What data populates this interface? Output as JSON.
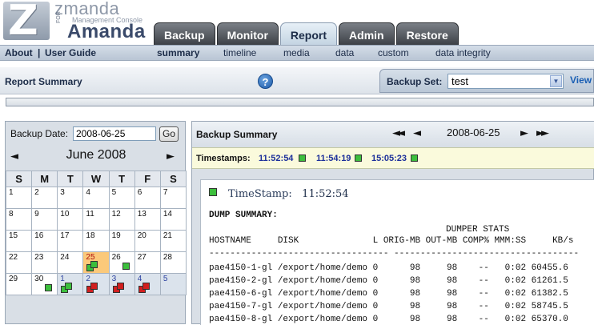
{
  "brand": {
    "name": "zmanda",
    "subtitle": "Management Console",
    "for_label": "FOR",
    "product": "Amanda"
  },
  "tabs": [
    {
      "label": "Backup",
      "active": false
    },
    {
      "label": "Monitor",
      "active": false
    },
    {
      "label": "Report",
      "active": true
    },
    {
      "label": "Admin",
      "active": false
    },
    {
      "label": "Restore",
      "active": false
    }
  ],
  "subnav": {
    "about": "About",
    "separator": "|",
    "user_guide": "User Guide",
    "items": [
      {
        "label": "summary",
        "active": true
      },
      {
        "label": "timeline",
        "active": false
      },
      {
        "label": "media",
        "active": false
      },
      {
        "label": "data",
        "active": false
      },
      {
        "label": "custom",
        "active": false
      },
      {
        "label": "data integrity",
        "active": false
      }
    ]
  },
  "report_summary": {
    "title": "Report Summary",
    "help_icon": "help-icon",
    "help_glyph": "?"
  },
  "backup_set": {
    "label": "Backup Set:",
    "value": "test",
    "view_link": "View"
  },
  "left_panel": {
    "backup_date_label": "Backup Date:",
    "backup_date_value": "2008-06-25",
    "go_label": "Go",
    "prev_glyph": "◄",
    "next_glyph": "►",
    "month": "June 2008",
    "weekdays": [
      "S",
      "M",
      "T",
      "W",
      "T",
      "F",
      "S"
    ],
    "weeks": [
      [
        {
          "d": "1"
        },
        {
          "d": "2"
        },
        {
          "d": "3"
        },
        {
          "d": "4"
        },
        {
          "d": "5"
        },
        {
          "d": "6"
        },
        {
          "d": "7"
        }
      ],
      [
        {
          "d": "8"
        },
        {
          "d": "9"
        },
        {
          "d": "10"
        },
        {
          "d": "11"
        },
        {
          "d": "12"
        },
        {
          "d": "13"
        },
        {
          "d": "14"
        }
      ],
      [
        {
          "d": "15"
        },
        {
          "d": "16"
        },
        {
          "d": "17"
        },
        {
          "d": "18"
        },
        {
          "d": "19"
        },
        {
          "d": "20"
        },
        {
          "d": "21"
        }
      ],
      [
        {
          "d": "22"
        },
        {
          "d": "23"
        },
        {
          "d": "24"
        },
        {
          "d": "25",
          "selected": true,
          "status": [
            "green",
            "green"
          ]
        },
        {
          "d": "26",
          "status": [
            "green"
          ]
        },
        {
          "d": "27"
        },
        {
          "d": "28"
        }
      ],
      [
        {
          "d": "29"
        },
        {
          "d": "30",
          "status": [
            "green"
          ]
        },
        {
          "d": "1",
          "out": true,
          "status": [
            "green",
            "green"
          ]
        },
        {
          "d": "2",
          "out": true,
          "status": [
            "red",
            "red"
          ]
        },
        {
          "d": "3",
          "out": true,
          "status": [
            "red",
            "red"
          ]
        },
        {
          "d": "4",
          "out": true,
          "status": [
            "red",
            "red"
          ]
        },
        {
          "d": "5",
          "out": true
        }
      ]
    ]
  },
  "backup_summary": {
    "title": "Backup Summary",
    "first_glyph": "◄◄",
    "prev_glyph": "◄",
    "date": "2008-06-25",
    "next_glyph": "►",
    "last_glyph": "►►",
    "timestamps_label": "Timestamps:",
    "timestamps": [
      "11:52:54",
      "11:54:19",
      "15:05:23"
    ],
    "report": {
      "timestamp_label": "TimeStamp:",
      "timestamp_value": "11:52:54",
      "dump_summary": "DUMP SUMMARY:",
      "dumper_stats": "DUMPER STATS",
      "headers": "HOSTNAME     DISK              L ORIG-MB OUT-MB COMP% MMM:SS     KB/s",
      "rule": "---------------------------------- -----------------------------------",
      "rows": [
        "pae4150-1-gl /export/home/demo 0      98     98    --   0:02 60455.6",
        "pae4150-2-gl /export/home/demo 0      98     98    --   0:02 61261.5",
        "pae4150-6-gl /export/home/demo 0      98     98    --   0:02 61382.5",
        "pae4150-7-gl /export/home/demo 0      98     98    --   0:02 58745.5",
        "pae4150-8-gl /export/home/demo 0      98     98    --   0:02 65370.0"
      ]
    }
  }
}
